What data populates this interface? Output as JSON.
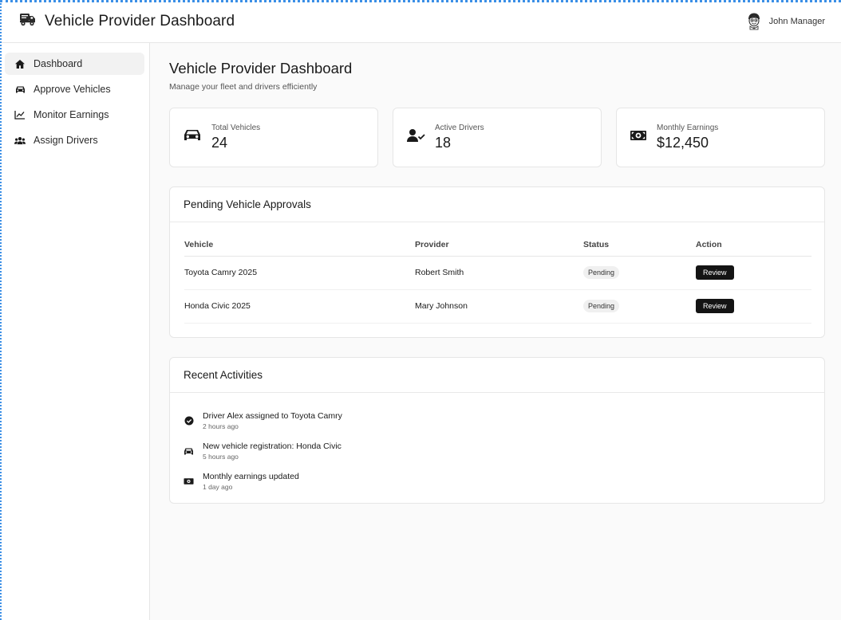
{
  "header": {
    "title": "Vehicle Provider Dashboard",
    "user_name": "John Manager"
  },
  "sidebar": {
    "items": [
      {
        "label": "Dashboard",
        "icon": "home-icon",
        "active": true
      },
      {
        "label": "Approve Vehicles",
        "icon": "car-icon",
        "active": false
      },
      {
        "label": "Monitor Earnings",
        "icon": "chart-line-icon",
        "active": false
      },
      {
        "label": "Assign Drivers",
        "icon": "users-icon",
        "active": false
      }
    ]
  },
  "main": {
    "title": "Vehicle Provider Dashboard",
    "subtitle": "Manage your fleet and drivers efficiently",
    "stats": [
      {
        "label": "Total Vehicles",
        "value": "24",
        "icon": "car-icon"
      },
      {
        "label": "Active Drivers",
        "value": "18",
        "icon": "user-check-icon"
      },
      {
        "label": "Monthly Earnings",
        "value": "$12,450",
        "icon": "money-bill-icon"
      }
    ],
    "approvals": {
      "title": "Pending Vehicle Approvals",
      "columns": [
        "Vehicle",
        "Provider",
        "Status",
        "Action"
      ],
      "rows": [
        {
          "vehicle": "Toyota Camry 2025",
          "provider": "Robert Smith",
          "status": "Pending",
          "action": "Review"
        },
        {
          "vehicle": "Honda Civic 2025",
          "provider": "Mary Johnson",
          "status": "Pending",
          "action": "Review"
        }
      ]
    },
    "activities": {
      "title": "Recent Activities",
      "items": [
        {
          "text": "Driver Alex assigned to Toyota Camry",
          "time": "2 hours ago",
          "icon": "check-circle-icon"
        },
        {
          "text": "New vehicle registration: Honda Civic",
          "time": "5 hours ago",
          "icon": "car-icon"
        },
        {
          "text": "Monthly earnings updated",
          "time": "1 day ago",
          "icon": "money-bill-icon"
        }
      ]
    }
  },
  "colors": {
    "accent": "#141414",
    "background": "#fafafa",
    "border": "#e6e6e6",
    "frame": "#3b8fe6"
  }
}
